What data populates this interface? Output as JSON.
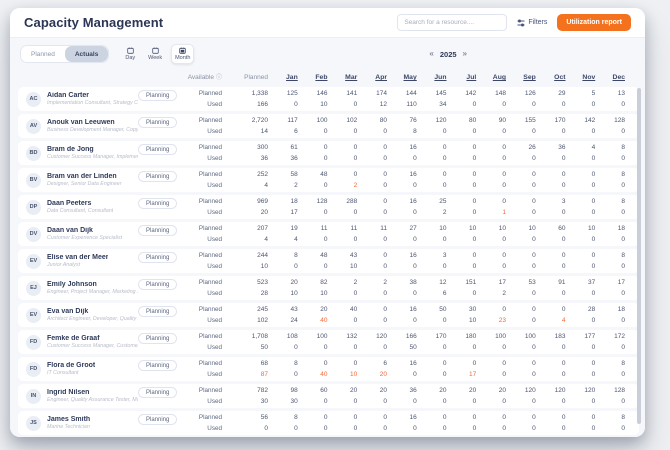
{
  "header": {
    "title": "Capacity Management",
    "search_placeholder": "Search for a resource....",
    "filters_label": "Filters",
    "report_button": "Utilization report"
  },
  "toolbar": {
    "tabs": [
      {
        "label": "Planned",
        "active": false
      },
      {
        "label": "Actuals",
        "active": true
      }
    ],
    "views": [
      {
        "label": "Day",
        "active": false
      },
      {
        "label": "Week",
        "active": false
      },
      {
        "label": "Month",
        "active": true
      }
    ],
    "prev_icon": "«",
    "next_icon": "»",
    "year": "2025"
  },
  "colors": {
    "accent_orange": "#f4711d",
    "over_value_orange": "#f06a3a",
    "active_segment": "#ccd4e2"
  },
  "table": {
    "available_header": "Available",
    "planned_header": "Planned",
    "months": [
      "Jan",
      "Feb",
      "Mar",
      "Apr",
      "May",
      "Jun",
      "Jul",
      "Aug",
      "Sep",
      "Oct",
      "Nov",
      "Dec"
    ],
    "row_labels": {
      "planned": "Planned",
      "used": "Used"
    },
    "planning_button": "Planning",
    "rows": [
      {
        "initials": "AC",
        "name": "Aidan Carter",
        "roles": "Implementation Consultant, Strategy C...",
        "planned_total": "1,338",
        "planned": [
          125,
          146,
          141,
          174,
          144,
          145,
          142,
          148,
          126,
          29,
          5,
          13
        ],
        "used_total": "166",
        "used": [
          0,
          10,
          0,
          12,
          110,
          34,
          0,
          0,
          0,
          0,
          0,
          0
        ],
        "used_over": [],
        "used_total_over": false
      },
      {
        "initials": "AV",
        "name": "Anouk van Leeuwen",
        "roles": "Business Development Manager, Copy...",
        "planned_total": "2,720",
        "planned": [
          117,
          100,
          102,
          80,
          76,
          120,
          80,
          90,
          155,
          170,
          142,
          128
        ],
        "used_total": "14",
        "used": [
          6,
          0,
          0,
          0,
          8,
          0,
          0,
          0,
          0,
          0,
          0,
          0
        ],
        "used_over": [],
        "used_total_over": false
      },
      {
        "initials": "BD",
        "name": "Bram de Jong",
        "roles": "Customer Success Manager, Implement...",
        "planned_total": "300",
        "planned": [
          61,
          0,
          0,
          0,
          16,
          0,
          0,
          0,
          26,
          36,
          4,
          8
        ],
        "used_total": "36",
        "used": [
          36,
          0,
          0,
          0,
          0,
          0,
          0,
          0,
          0,
          0,
          0,
          0
        ],
        "used_over": [],
        "used_total_over": false
      },
      {
        "initials": "BV",
        "name": "Bram van der Linden",
        "roles": "Designer, Senior Data Engineer",
        "planned_total": "252",
        "planned": [
          58,
          48,
          0,
          0,
          16,
          0,
          0,
          0,
          0,
          0,
          0,
          8
        ],
        "used_total": "4",
        "used": [
          2,
          0,
          2,
          0,
          0,
          0,
          0,
          0,
          0,
          0,
          0,
          0
        ],
        "used_over": [
          2
        ],
        "used_total_over": false
      },
      {
        "initials": "DP",
        "name": "Daan Peeters",
        "roles": "Data Consultant, Consultant",
        "planned_total": "969",
        "planned": [
          18,
          128,
          288,
          0,
          16,
          25,
          0,
          0,
          0,
          3,
          0,
          8
        ],
        "used_total": "20",
        "used": [
          17,
          0,
          0,
          0,
          0,
          2,
          0,
          1,
          0,
          0,
          0,
          0
        ],
        "used_over": [
          7
        ],
        "used_total_over": false
      },
      {
        "initials": "DV",
        "name": "Daan van Dijk",
        "roles": "Customer Experience Specialist",
        "planned_total": "207",
        "planned": [
          19,
          11,
          11,
          11,
          27,
          10,
          10,
          10,
          10,
          60,
          10,
          18
        ],
        "used_total": "4",
        "used": [
          4,
          0,
          0,
          0,
          0,
          0,
          0,
          0,
          0,
          0,
          0,
          0
        ],
        "used_over": [],
        "used_total_over": false
      },
      {
        "initials": "EV",
        "name": "Elise van der Meer",
        "roles": "Junior Analyst",
        "planned_total": "244",
        "planned": [
          8,
          48,
          43,
          0,
          16,
          3,
          0,
          0,
          0,
          0,
          0,
          8
        ],
        "used_total": "10",
        "used": [
          0,
          0,
          10,
          0,
          0,
          0,
          0,
          0,
          0,
          0,
          0,
          0
        ],
        "used_over": [],
        "used_total_over": false
      },
      {
        "initials": "EJ",
        "name": "Emily Johnson",
        "roles": "Engineer, Project Manager, Marketing ...",
        "planned_total": "523",
        "planned": [
          20,
          82,
          2,
          2,
          38,
          12,
          151,
          17,
          53,
          91,
          37,
          17
        ],
        "used_total": "28",
        "used": [
          10,
          10,
          0,
          0,
          0,
          6,
          0,
          2,
          0,
          0,
          0,
          0
        ],
        "used_over": [],
        "used_total_over": false
      },
      {
        "initials": "EV",
        "name": "Eva van Dijk",
        "roles": "Architect Engineer, Developer, Quality ...",
        "planned_total": "245",
        "planned": [
          43,
          20,
          40,
          0,
          16,
          50,
          30,
          0,
          0,
          0,
          28,
          18
        ],
        "used_total": "102",
        "used": [
          24,
          40,
          0,
          0,
          0,
          0,
          10,
          23,
          0,
          4,
          0,
          0
        ],
        "used_over": [
          1,
          7,
          9
        ],
        "used_total_over": false
      },
      {
        "initials": "FD",
        "name": "Femke de Graaf",
        "roles": "Customer Success Manager, Customer ...",
        "planned_total": "1,708",
        "planned": [
          108,
          100,
          132,
          120,
          166,
          170,
          180,
          100,
          100,
          183,
          177,
          172
        ],
        "used_total": "50",
        "used": [
          0,
          0,
          0,
          0,
          50,
          0,
          0,
          0,
          0,
          0,
          0,
          0
        ],
        "used_over": [],
        "used_total_over": false
      },
      {
        "initials": "FD",
        "name": "Flora de Groot",
        "roles": "IT Consultant",
        "planned_total": "68",
        "planned": [
          8,
          0,
          0,
          6,
          16,
          0,
          0,
          0,
          0,
          0,
          0,
          8
        ],
        "used_total": "87",
        "used": [
          0,
          40,
          10,
          20,
          0,
          0,
          17,
          0,
          0,
          0,
          0,
          0
        ],
        "used_over": [
          1,
          2,
          3,
          6
        ],
        "used_total_over": true
      },
      {
        "initials": "IN",
        "name": "Ingrid Nilsen",
        "roles": "Engineer, Quality Assurance Tester, Ma...",
        "planned_total": "782",
        "planned": [
          98,
          60,
          20,
          20,
          36,
          20,
          20,
          20,
          120,
          120,
          120,
          128
        ],
        "used_total": "30",
        "used": [
          30,
          0,
          0,
          0,
          0,
          0,
          0,
          0,
          0,
          0,
          0,
          0
        ],
        "used_over": [],
        "used_total_over": false
      },
      {
        "initials": "JS",
        "name": "James Smith",
        "roles": "Marine Technician",
        "planned_total": "56",
        "planned": [
          8,
          0,
          0,
          0,
          16,
          0,
          0,
          0,
          0,
          0,
          0,
          8
        ],
        "used_total": "0",
        "used": [
          0,
          0,
          0,
          0,
          0,
          0,
          0,
          0,
          0,
          0,
          0,
          0
        ],
        "used_over": [],
        "used_total_over": false
      }
    ]
  }
}
